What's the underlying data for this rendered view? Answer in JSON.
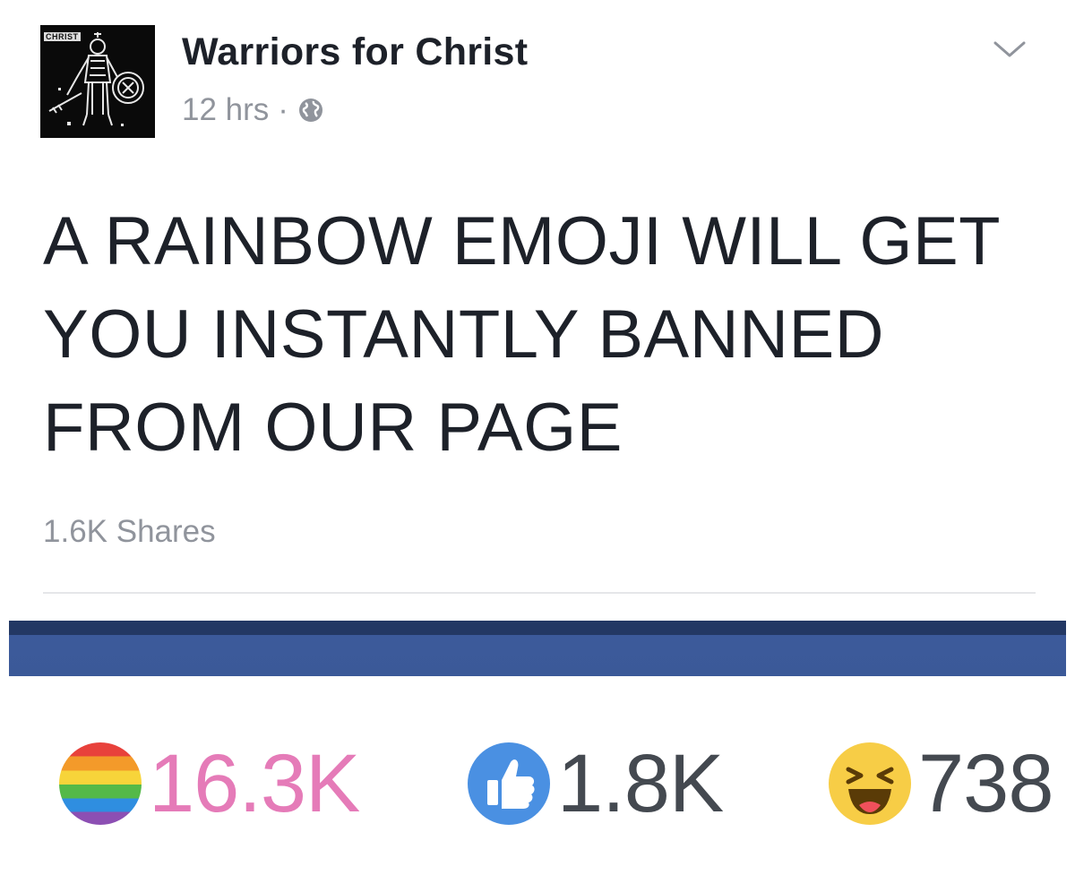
{
  "post": {
    "page_name": "Warriors for Christ",
    "avatar_tag": "CHRIST",
    "time": "12 hrs",
    "separator": "·",
    "visibility_icon": "globe-icon",
    "menu_icon": "chevron-down-icon",
    "status_lines": [
      "A RAINBOW EMOJI WILL GET",
      "YOU INSTANTLY BANNED",
      "FROM OUR PAGE"
    ],
    "shares": "1.6K Shares"
  },
  "reactions": [
    {
      "name": "rainbow",
      "icon": "rainbow-flag-icon",
      "count": "16.3K",
      "color": "#e57bb8"
    },
    {
      "name": "like",
      "icon": "thumbs-up-icon",
      "count": "1.8K",
      "color": "#444950"
    },
    {
      "name": "haha",
      "icon": "laughing-face-icon",
      "count": "738",
      "color": "#444950"
    }
  ],
  "colors": {
    "header_text": "#1d2129",
    "meta_text": "#90949c",
    "bar_blue": "#3b5998",
    "bar_dark": "#233864"
  }
}
